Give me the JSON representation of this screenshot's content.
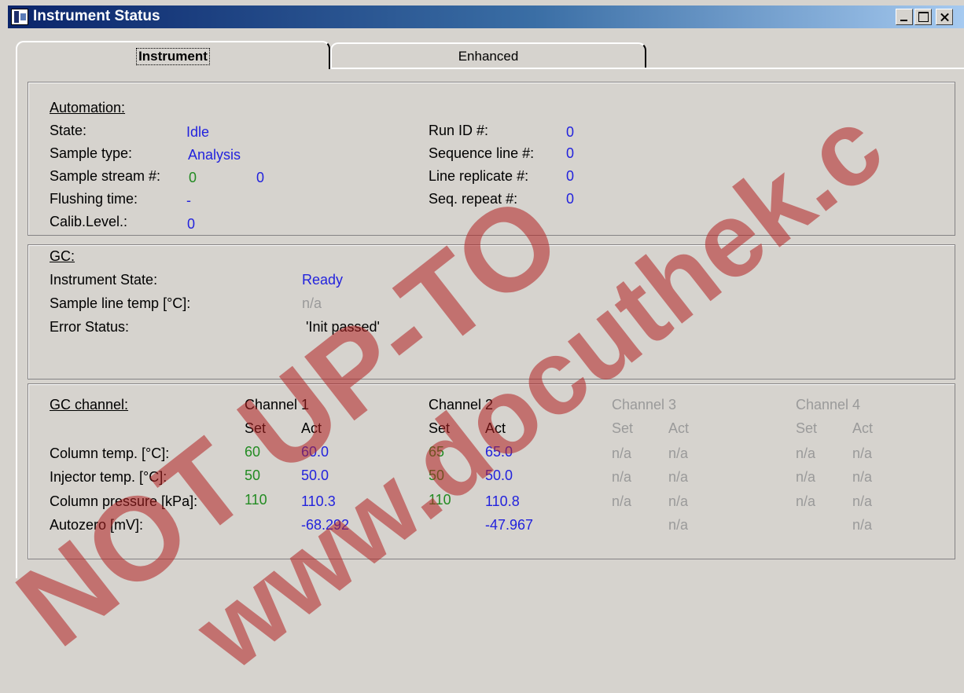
{
  "window": {
    "title": "Instrument Status"
  },
  "tabs": [
    "Instrument",
    "Enhanced"
  ],
  "automation": {
    "header": "Automation:",
    "state_label": "State:",
    "state_value": "Idle",
    "sample_type_label": "Sample type:",
    "sample_type_value": "Analysis",
    "sample_stream_label": "Sample stream #:",
    "sample_stream_value1": "0",
    "sample_stream_value2": "0",
    "flushing_label": "Flushing time:",
    "flushing_value": "-",
    "calib_label": "Calib.Level.:",
    "calib_value": "0",
    "run_id_label": "Run ID #:",
    "run_id_value": "0",
    "seq_line_label": "Sequence line #:",
    "seq_line_value": "0",
    "line_rep_label": "Line replicate #:",
    "line_rep_value": "0",
    "seq_repeat_label": "Seq. repeat #:",
    "seq_repeat_value": "0"
  },
  "gc": {
    "header": "GC:",
    "instrument_state_label": "Instrument State:",
    "instrument_state_value": "Ready",
    "sample_line_label": "Sample line temp [°C]:",
    "sample_line_value": "n/a",
    "error_label": "Error Status:",
    "error_value": "'Init passed'"
  },
  "gc_channel": {
    "header": "GC channel:",
    "set_label": "Set",
    "act_label": "Act",
    "row_labels": [
      "Column temp. [°C]:",
      "Injector temp. [°C]:",
      "Column pressure [kPa]:",
      "Autozero [mV]:"
    ],
    "channels": [
      {
        "name": "Channel 1",
        "set": [
          "60",
          "50",
          "110",
          ""
        ],
        "act": [
          "60.0",
          "50.0",
          "110.3",
          "-68.292"
        ]
      },
      {
        "name": "Channel 2",
        "set": [
          "65",
          "50",
          "110",
          ""
        ],
        "act": [
          "65.0",
          "50.0",
          "110.8",
          "-47.967"
        ]
      },
      {
        "name": "Channel 3",
        "set": [
          "n/a",
          "n/a",
          "n/a",
          ""
        ],
        "act": [
          "n/a",
          "n/a",
          "n/a",
          "n/a"
        ]
      },
      {
        "name": "Channel 4",
        "set": [
          "n/a",
          "n/a",
          "n/a",
          ""
        ],
        "act": [
          "n/a",
          "n/a",
          "n/a",
          "n/a"
        ]
      }
    ]
  },
  "watermarks": [
    "NOT UP-TO",
    "www.docuthek.c"
  ],
  "colors": {
    "title_start": "#0a246a",
    "title_end": "#a6caf0",
    "value_blue": "#2222dd",
    "set_green": "#228b22",
    "disabled_grey": "#9a9a9a",
    "watermark_red": "#b22222"
  }
}
